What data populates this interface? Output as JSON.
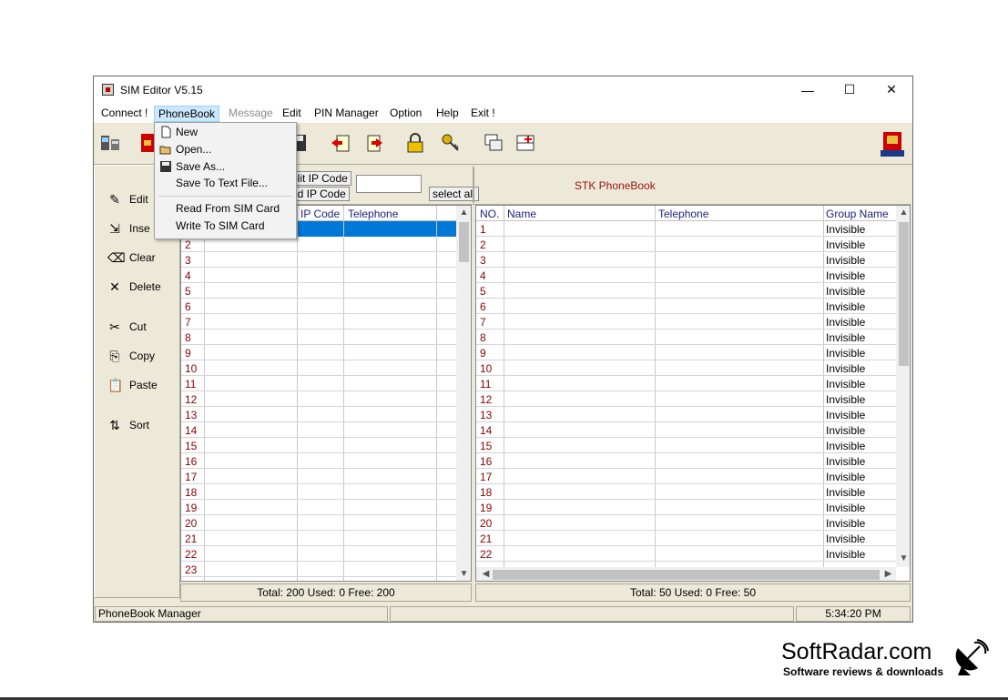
{
  "window": {
    "title": "SIM Editor V5.15"
  },
  "window_controls": {
    "minimize": "—",
    "maximize": "☐",
    "close": "✕"
  },
  "menu": [
    "Connect !",
    "PhoneBook",
    "Message",
    "Edit",
    "PIN Manager",
    "Option",
    "Help",
    "Exit !"
  ],
  "dropdown": {
    "items": [
      "New",
      "Open...",
      "Save As...",
      "Save To Text File...",
      "Read From SIM Card",
      "Write To SIM Card"
    ]
  },
  "left_actions": [
    "Edit",
    "Inse",
    "Clear",
    "Delete",
    "Cut",
    "Copy",
    "Paste",
    "Sort"
  ],
  "strip": {
    "split_ip": "plit IP Code",
    "add_ip": "dd IP Code",
    "select_all": "select all",
    "stk_title": "STK  PhoneBook"
  },
  "left_grid": {
    "headers": [
      "IP Code",
      "Telephone"
    ],
    "rows": [
      "2",
      "3",
      "4",
      "5",
      "6",
      "7",
      "8",
      "9",
      "10",
      "11",
      "12",
      "13",
      "14",
      "15",
      "16",
      "17",
      "18",
      "19",
      "20",
      "21",
      "22",
      "23"
    ],
    "total": "Total: 200  Used: 0  Free: 200"
  },
  "right_grid": {
    "headers": [
      "NO.",
      "Name",
      "Telephone",
      "Group Name"
    ],
    "rows": [
      "1",
      "2",
      "3",
      "4",
      "5",
      "6",
      "7",
      "8",
      "9",
      "10",
      "11",
      "12",
      "13",
      "14",
      "15",
      "16",
      "17",
      "18",
      "19",
      "20",
      "21",
      "22"
    ],
    "group_value": "Invisible",
    "total": "Total: 50  Used: 0  Free: 50"
  },
  "status": {
    "left": "PhoneBook Manager",
    "time": "5:34:20 PM"
  },
  "brand": {
    "name": "SoftRadar.com",
    "tagline": "Software reviews & downloads"
  },
  "colors": {
    "accent": "#cce8ff",
    "row_number": "#8b0000",
    "header_text": "#1a237e",
    "stk_title": "#9b1111",
    "selection": "#0078d7"
  }
}
